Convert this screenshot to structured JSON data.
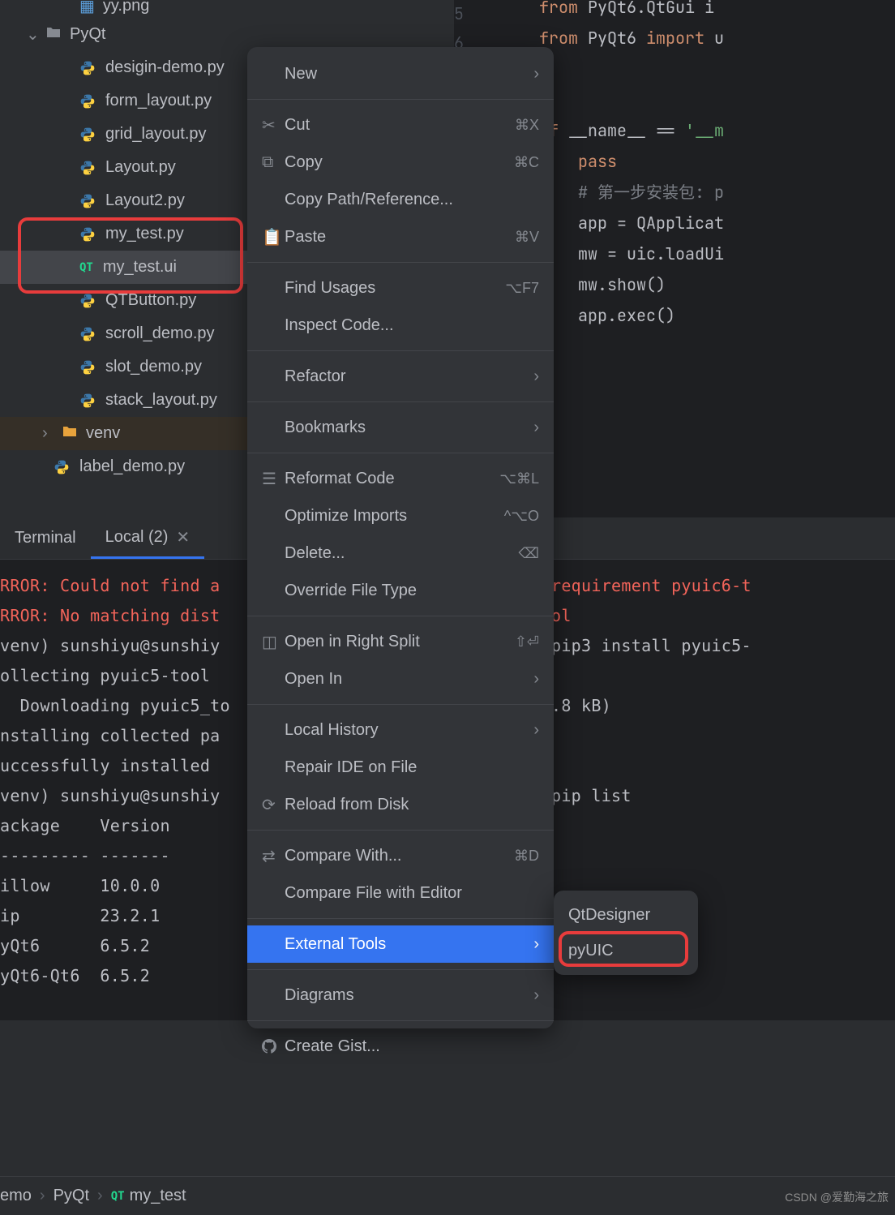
{
  "tree": {
    "top_file": "yy.png",
    "folder": "PyQt",
    "files": [
      "desigin-demo.py",
      "form_layout.py",
      "grid_layout.py",
      "Layout.py",
      "Layout2.py",
      "my_test.py",
      "my_test.ui",
      "QTButton.py",
      "scroll_demo.py",
      "slot_demo.py",
      "stack_layout.py"
    ],
    "venv": "venv",
    "bottom_file": "label_demo.py"
  },
  "editor": {
    "line5": "5",
    "line6": "6",
    "l1a": "from",
    "l1b": " PyQt6.QtGui i",
    "l2a": "from",
    "l2b": " PyQt6 ",
    "l2c": "import",
    "l2d": " u",
    "l4a": "if",
    "l4b": " __name__ ",
    "l4c": "==",
    "l4d": " '__m",
    "l5a": "pass",
    "l6a": "# 第一步安装包: p",
    "l7a": "app = QApplicat",
    "l8a": "mw = uic.loadUi",
    "l9a": "mw.show()",
    "l10a": "app.exec()"
  },
  "terminal": {
    "tab1": "Terminal",
    "tab2": "Local (2)",
    "lines_left": [
      "RROR: Could not find a",
      "RROR: No matching dist",
      "venv) sunshiyu@sunshiy",
      "ollecting pyuic5-tool",
      "  Downloading pyuic5_to",
      "nstalling collected pa",
      "uccessfully installed ",
      "venv) sunshiyu@sunshiy",
      "ackage    Version",
      "--------- -------",
      "illow     10.0.0",
      "ip        23.2.1",
      "yQt6      6.5.2",
      "yQt6-Qt6  6.5.2"
    ],
    "lines_right": [
      "requirement pyuic6-t",
      "ol",
      "pip3 install pyuic5-",
      "",
      ".8 kB)",
      "",
      "",
      "pip list"
    ]
  },
  "breadcrumb": {
    "p1": "emo",
    "p2": "PyQt",
    "p3": "my_test"
  },
  "menu": {
    "new": "New",
    "cut": "Cut",
    "cut_sc": "⌘X",
    "copy": "Copy",
    "copy_sc": "⌘C",
    "copypath": "Copy Path/Reference...",
    "paste": "Paste",
    "paste_sc": "⌘V",
    "findusages": "Find Usages",
    "findusages_sc": "⌥F7",
    "inspect": "Inspect Code...",
    "refactor": "Refactor",
    "bookmarks": "Bookmarks",
    "reformat": "Reformat Code",
    "reformat_sc": "⌥⌘L",
    "optimize": "Optimize Imports",
    "optimize_sc": "^⌥O",
    "delete": "Delete...",
    "delete_sc": "⌫",
    "override": "Override File Type",
    "opensplit": "Open in Right Split",
    "opensplit_sc": "⇧⏎",
    "openin": "Open In",
    "localhist": "Local History",
    "repair": "Repair IDE on File",
    "reload": "Reload from Disk",
    "compare": "Compare With...",
    "compare_sc": "⌘D",
    "compareed": "Compare File with Editor",
    "external": "External Tools",
    "diagrams": "Diagrams",
    "gist": "Create Gist..."
  },
  "submenu": {
    "qtdesigner": "QtDesigner",
    "pyuic": "pyUIC"
  },
  "watermark": "CSDN @爱勤海之旅"
}
